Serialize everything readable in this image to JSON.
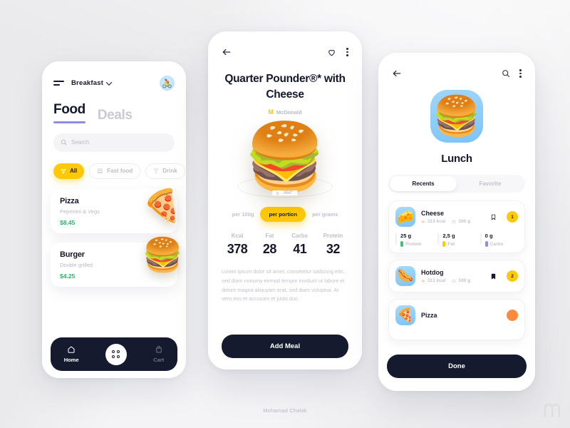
{
  "footer": {
    "credit": "Mohamad Chalak",
    "watermark_icon": "m-logo-watermark"
  },
  "colors": {
    "accent_yellow": "#ffc907",
    "dark_navy": "#161a2e",
    "price_green": "#24b96a",
    "tab_underline_purple": "#8b8de8",
    "muted_gray": "#c2c3cc",
    "hero_blue": "#8ecdf8"
  },
  "left_phone": {
    "menu_icon": "hamburger-icon",
    "meal_selector": {
      "label": "Breakfast",
      "chevron_icon": "chevron-down-icon"
    },
    "avatar_icon": "user-avatar",
    "tabs": [
      {
        "label": "Food",
        "active": true
      },
      {
        "label": "Deals",
        "active": false
      }
    ],
    "search": {
      "placeholder": "Search",
      "icon": "search-icon"
    },
    "chips": [
      {
        "label": "All",
        "icon": "filter-icon",
        "active": true
      },
      {
        "label": "Fast food",
        "icon": "burger-icon",
        "active": false
      },
      {
        "label": "Drink",
        "icon": "cocktail-icon",
        "active": false
      }
    ],
    "cards": [
      {
        "name": "Pizza",
        "desc": "Peperoni & Vegs",
        "price": "$8.45",
        "image": "pizza"
      },
      {
        "name": "Burger",
        "desc": "Double grilled",
        "price": "$4.25",
        "image": "burger"
      }
    ],
    "nav": [
      {
        "label": "Home",
        "icon": "home-icon",
        "active": true
      },
      {
        "label": "",
        "icon": "grid-dots-icon",
        "active": false
      },
      {
        "label": "Cart",
        "icon": "bag-icon",
        "active": false
      }
    ]
  },
  "center_phone": {
    "back_icon": "arrow-left-icon",
    "favorite_icon": "heart-icon",
    "more_icon": "kebab-menu-icon",
    "title": "Quarter Pounder®* with Cheese",
    "brand": "McDonald",
    "brand_logo_icon": "mcdonalds-logo",
    "hero_image": "burger-3d",
    "rotate_label": "360°",
    "rotate_icon": "play-triangle-icon",
    "portion_tabs": [
      {
        "label": "per 100g",
        "active": false
      },
      {
        "label": "per portion",
        "active": true
      },
      {
        "label": "per grams",
        "active": false
      }
    ],
    "macros": [
      {
        "key": "Kcal",
        "value": "378"
      },
      {
        "key": "Fat",
        "value": "28"
      },
      {
        "key": "Carbs",
        "value": "41"
      },
      {
        "key": "Protein",
        "value": "32"
      }
    ],
    "description": "Lorem ipsum dolor sit amet, consetetur sadscing elitr, sed diam nonumy eirmod tempor invidunt ut labore et dolore magna aliquyam erat, sed diam voluptua. At vero eos et accusam et justo duo",
    "cta_label": "Add Meal"
  },
  "right_phone": {
    "back_icon": "arrow-left-icon",
    "search_icon": "search-icon",
    "more_icon": "kebab-menu-icon",
    "hero_image": "burger-3d",
    "title": "Lunch",
    "segments": [
      {
        "label": "Recents",
        "active": true
      },
      {
        "label": "Favorite",
        "active": false
      }
    ],
    "items": [
      {
        "name": "Cheese",
        "thumb": "cheese",
        "kcal": "113 kcal",
        "weight": "100 g",
        "kcal_icon": "flame-icon",
        "weight_icon": "weight-icon",
        "bookmark_icon": "bookmark-outline-icon",
        "badge": "1",
        "nutrition": [
          {
            "value": "25 g",
            "label": "Protein",
            "color": "#3ec47a"
          },
          {
            "value": "2,5 g",
            "label": "Fat",
            "color": "#ffc907"
          },
          {
            "value": "0 g",
            "label": "Carbs",
            "color": "#8b8de8"
          }
        ]
      },
      {
        "name": "Hotdog",
        "thumb": "hotdog",
        "kcal": "113 kcal",
        "weight": "100 g",
        "kcal_icon": "flame-icon",
        "weight_icon": "weight-icon",
        "bookmark_icon": "bookmark-filled-icon",
        "badge": "2",
        "nutrition": []
      },
      {
        "name": "Pizza",
        "thumb": "pizza",
        "kcal": "",
        "weight": "",
        "kcal_icon": "flame-icon",
        "weight_icon": "weight-icon",
        "bookmark_icon": "bookmark-outline-icon",
        "badge": "",
        "nutrition": []
      }
    ],
    "cta_label": "Done"
  }
}
